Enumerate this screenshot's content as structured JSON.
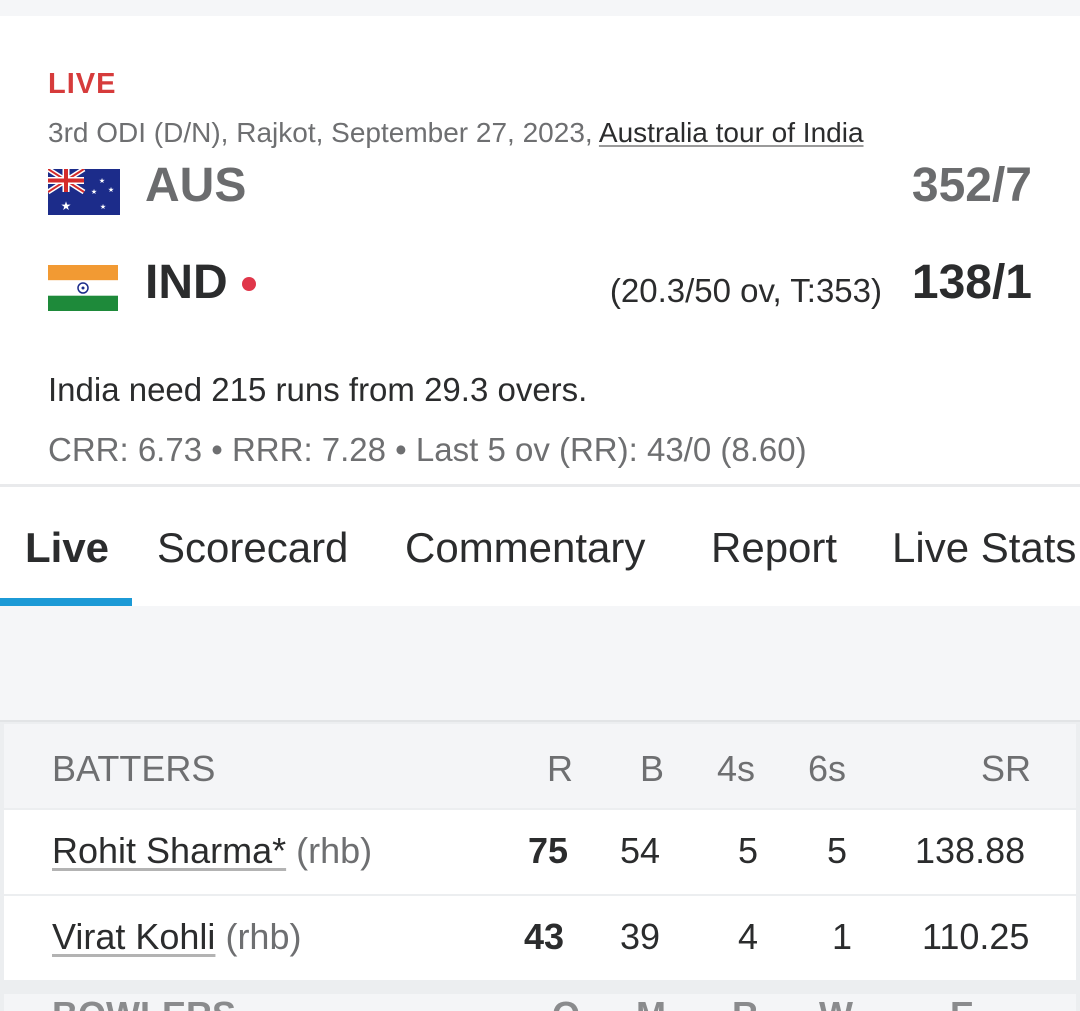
{
  "match": {
    "live_label": "LIVE",
    "meta_text": "3rd ODI (D/N), Rajkot, September 27, 2023, ",
    "series_link": "Australia tour of India",
    "teams": [
      {
        "code": "AUS",
        "score": "352/7"
      },
      {
        "code": "IND",
        "overs_target": "(20.3/50 ov, T:353)",
        "score": "138/1"
      }
    ],
    "status": "India need 215 runs from 29.3 overs.",
    "rates": "CRR: 6.73 • RRR: 7.28 • Last 5 ov (RR): 43/0 (8.60)"
  },
  "tabs": [
    "Live",
    "Scorecard",
    "Commentary",
    "Report",
    "Live Stats"
  ],
  "active_tab": "Live",
  "colors": {
    "live_red": "#d63b3b",
    "active_tab_underline": "#1c9ad6",
    "batting_dot": "#e0364a"
  },
  "batters_table": {
    "headers": [
      "BATTERS",
      "R",
      "B",
      "4s",
      "6s",
      "SR"
    ],
    "rows": [
      {
        "name": "Rohit Sharma*",
        "style": "(rhb)",
        "r": "75",
        "b": "54",
        "fours": "5",
        "sixes": "5",
        "sr": "138.88"
      },
      {
        "name": "Virat Kohli",
        "style": "(rhb)",
        "r": "43",
        "b": "39",
        "fours": "4",
        "sixes": "1",
        "sr": "110.25"
      }
    ]
  },
  "bowlers_header_partial": [
    "BOWLERS",
    "O",
    "M",
    "R",
    "W",
    "E"
  ]
}
